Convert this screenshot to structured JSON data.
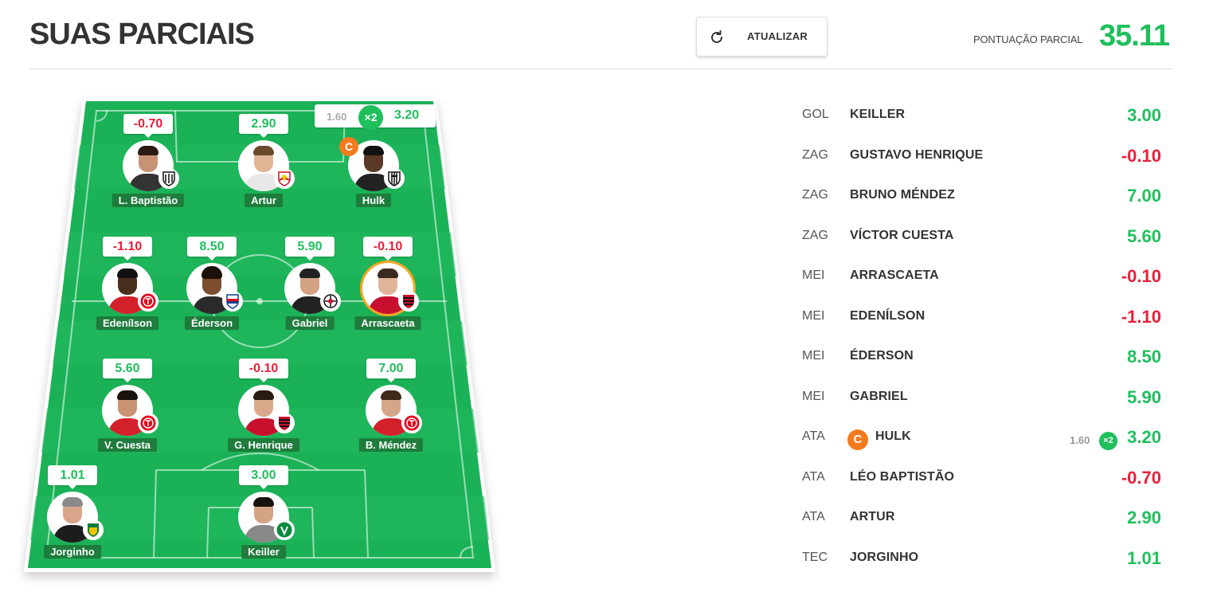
{
  "header": {
    "title": "SUAS PARCIAIS",
    "refresh_label": "ATUALIZAR",
    "total_label": "PONTUAÇÃO PARCIAL",
    "total_value": "35.11"
  },
  "colors": {
    "positive": "#1fbf5c",
    "negative": "#e8203a",
    "captain": "#f47a20",
    "field": "#1fb15a"
  },
  "captain": {
    "base": "1.60",
    "multiplier": "×2",
    "final": "3.20",
    "badge": "C"
  },
  "field": {
    "players": [
      {
        "name": "L. Baptistão",
        "score": "-0.70",
        "sign": "neg",
        "club": "santos-badge"
      },
      {
        "name": "Artur",
        "score": "2.90",
        "sign": "pos",
        "club": "bragantino-badge"
      },
      {
        "name": "Hulk",
        "score": "3.20",
        "sign": "pos",
        "club": "atletico-mg-badge",
        "captain": true
      },
      {
        "name": "Edenílson",
        "score": "-1.10",
        "sign": "neg",
        "club": "internacional-badge"
      },
      {
        "name": "Éderson",
        "score": "8.50",
        "sign": "pos",
        "club": "fortaleza-badge"
      },
      {
        "name": "Gabriel",
        "score": "5.90",
        "sign": "pos",
        "club": "corinthians-badge"
      },
      {
        "name": "Arrascaeta",
        "score": "-0.10",
        "sign": "neg",
        "club": "flamengo-badge"
      },
      {
        "name": "V. Cuesta",
        "score": "5.60",
        "sign": "pos",
        "club": "internacional-badge"
      },
      {
        "name": "G. Henrique",
        "score": "-0.10",
        "sign": "neg",
        "club": "flamengo-badge"
      },
      {
        "name": "B. Méndez",
        "score": "7.00",
        "sign": "pos",
        "club": "internacional-badge"
      },
      {
        "name": "Jorginho",
        "score": "1.01",
        "sign": "pos",
        "club": "cuiaba-badge"
      },
      {
        "name": "Keiller",
        "score": "3.00",
        "sign": "pos",
        "club": "chapecoense-badge"
      }
    ]
  },
  "list": {
    "rows": [
      {
        "pos": "GOL",
        "name": "KEILLER",
        "score": "3.00",
        "sign": "pos"
      },
      {
        "pos": "ZAG",
        "name": "GUSTAVO HENRIQUE",
        "score": "-0.10",
        "sign": "neg"
      },
      {
        "pos": "ZAG",
        "name": "BRUNO MÉNDEZ",
        "score": "7.00",
        "sign": "pos"
      },
      {
        "pos": "ZAG",
        "name": "VÍCTOR CUESTA",
        "score": "5.60",
        "sign": "pos"
      },
      {
        "pos": "MEI",
        "name": "ARRASCAETA",
        "score": "-0.10",
        "sign": "neg"
      },
      {
        "pos": "MEI",
        "name": "EDENÍLSON",
        "score": "-1.10",
        "sign": "neg"
      },
      {
        "pos": "MEI",
        "name": "ÉDERSON",
        "score": "8.50",
        "sign": "pos"
      },
      {
        "pos": "MEI",
        "name": "GABRIEL",
        "score": "5.90",
        "sign": "pos"
      },
      {
        "pos": "ATA",
        "name": "HULK",
        "score": "3.20",
        "sign": "pos",
        "captain": true,
        "base": "1.60",
        "multiplier": "×2"
      },
      {
        "pos": "ATA",
        "name": "LÉO BAPTISTÃO",
        "score": "-0.70",
        "sign": "neg"
      },
      {
        "pos": "ATA",
        "name": "ARTUR",
        "score": "2.90",
        "sign": "pos"
      },
      {
        "pos": "TEC",
        "name": "JORGINHO",
        "score": "1.01",
        "sign": "pos"
      }
    ]
  }
}
